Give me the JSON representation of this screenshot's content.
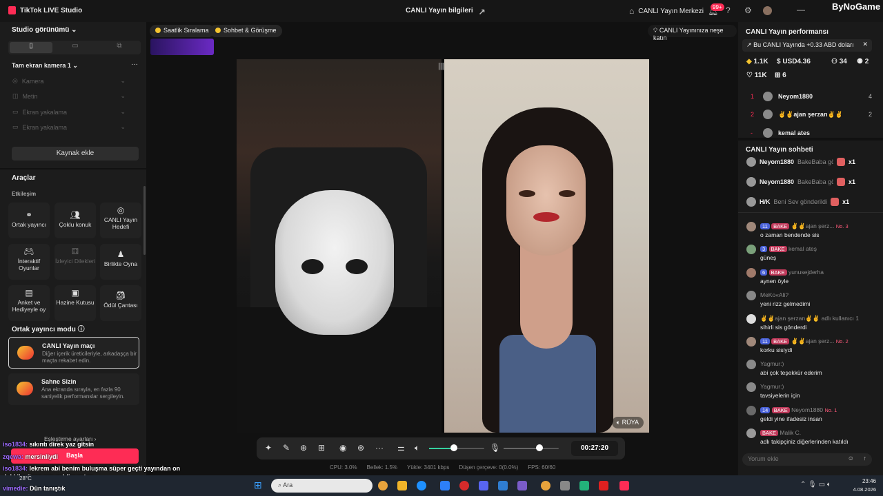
{
  "app": {
    "title": "TikTok LIVE Studio",
    "watermark": "ByNoGame"
  },
  "topbar": {
    "center_title": "CANLI Yayın bilgileri",
    "center_right": "CANLI Yayın Merkezi",
    "notif_badge": "99+"
  },
  "left": {
    "studio_view": "Studio görünümü",
    "scene": "Tam ekran kamera 1",
    "sources": [
      "Kamera",
      "Metin",
      "Ekran yakalama",
      "Ekran yakalama"
    ],
    "add_source": "Kaynak ekle",
    "tools_title": "Araçlar",
    "interaction": "Etkileşim",
    "tools": [
      {
        "label": "Ortak yayıncı",
        "icon": "link-icon"
      },
      {
        "label": "Çoklu konuk",
        "icon": "users-icon"
      },
      {
        "label": "CANLI Yayın Hedefi",
        "icon": "target-icon"
      },
      {
        "label": "İnteraktif Oyunlar",
        "icon": "gamepad-icon"
      },
      {
        "label": "İzleyici Dilekleri",
        "icon": "gift-icon"
      },
      {
        "label": "Birlikte Oyna",
        "icon": "play-together-icon"
      },
      {
        "label": "Anket ve Hediyeyle oy",
        "icon": "poll-icon"
      },
      {
        "label": "Hazine Kutusu",
        "icon": "chest-icon"
      },
      {
        "label": "Ödül Çantası",
        "icon": "bag-icon"
      }
    ],
    "cohost_mode": "Ortak yayıncı modu",
    "modes": [
      {
        "title": "CANLI Yayın maçı",
        "desc": "Diğer içerik üreticileriyle, arkadaşça bir maçta rekabet edin."
      },
      {
        "title": "Sahne Sizin",
        "desc": "Ana ekranda sırayla, en fazla 90 saniyelik performanslar sergileyin."
      }
    ],
    "pairing_settings": "Eşleştirme ayarları"
  },
  "center": {
    "chips": [
      "Saatlik Sıralama",
      "Sohbet & Görüşme"
    ],
    "promo_chip": "CANLI Yayınınıza neşe katın",
    "ruya": "RÜYA",
    "timer": "00:27:20",
    "volume": 0.45,
    "mic": 0.65,
    "status": [
      "CPU: 3.0%",
      "Bellek: 1.5%",
      "Yükle: 3401 kbps",
      "Düşen çerçeve: 0(0.0%)",
      "FPS: 60/60"
    ]
  },
  "right": {
    "perf_title": "CANLI Yayın performansı",
    "perf_notice": "Bu CANLI Yayında +0.33 ABD doları",
    "stats": {
      "diamonds": "1.1K",
      "usd": "USD4.36",
      "viewers": "34",
      "new": "2",
      "likes": "11K",
      "gifters": "6"
    },
    "ranking": [
      {
        "rank": "1",
        "name": "Neyom1880",
        "score": "4"
      },
      {
        "rank": "2",
        "name": "✌✌ajan şerzan✌✌",
        "score": "2"
      },
      {
        "rank": "-",
        "name": "kemal ates",
        "score": ""
      }
    ],
    "chat_title": "CANLI Yayın sohbeti",
    "gifts": [
      {
        "name": "Neyom1880",
        "text": "BakeBaba gönde",
        "count": "x1"
      },
      {
        "name": "Neyom1880",
        "text": "BakeBaba gönde",
        "count": "x1"
      },
      {
        "name": "H/K",
        "text": "Beni Sev gönderildi",
        "count": "x1"
      }
    ],
    "messages": [
      {
        "l1": "✌✌ajan şerz...",
        "lv": "11",
        "fan": "BAKE",
        "no": "No. 3",
        "l2": "o zaman bendende sis"
      },
      {
        "l1": "kemal ateş",
        "lv": "3",
        "fan": "BAKE",
        "no": "",
        "l2": "güneş"
      },
      {
        "l1": "yunusejderha",
        "lv": "6",
        "fan": "BAKE",
        "no": "",
        "l2": "aynen öyle"
      },
      {
        "l1": "MeKo«Ali?",
        "lv": "",
        "fan": "",
        "no": "",
        "l2": "yeni rizz gelmedimi"
      },
      {
        "l1": "✌✌ajan şerzan✌✌ adlı kullanıcı 1",
        "lv": "",
        "fan": "",
        "no": "",
        "l2": "sihirli sis gönderdi"
      },
      {
        "l1": "✌✌ajan şerz...",
        "lv": "11",
        "fan": "BAKE",
        "no": "No. 2",
        "l2": "korku sisiydi"
      },
      {
        "l1": "Yagmur:)",
        "lv": "",
        "fan": "",
        "no": "",
        "l2": "abi çok teşekkür ederim"
      },
      {
        "l1": "Yagmur:)",
        "lv": "",
        "fan": "",
        "no": "",
        "l2": "tavsiyelerin için"
      },
      {
        "l1": "Neyom1880",
        "lv": "14",
        "fan": "BAKE",
        "no": "No. 1",
        "l2": "geldi yine ifadesiz insan"
      },
      {
        "l1": "Malik C.",
        "lv": "",
        "fan": "BAKE",
        "no": "",
        "l2": "adlı takipçiniz diğerlerinden katıldı"
      }
    ],
    "comment_placeholder": "Yorum ekle"
  },
  "overlay": [
    {
      "user": "iso1834:",
      "text": "sıkıntı direk yaz gitsin"
    },
    {
      "user": "zqewa:",
      "text": "mersinliydi"
    },
    {
      "user": "iso1834:",
      "text": "lekrem abi benim buluşma süper geçti yayından on"
    },
    {
      "user": "",
      "text": "dakkika önce eve geldim zaten"
    },
    {
      "user": "vimedie:",
      "text": "Dün tanıştık"
    }
  ],
  "overlay_start": "Başla",
  "taskbar": {
    "search": "Ara",
    "weather": "28°C",
    "time": "23:46",
    "date": "4.08.2026"
  }
}
